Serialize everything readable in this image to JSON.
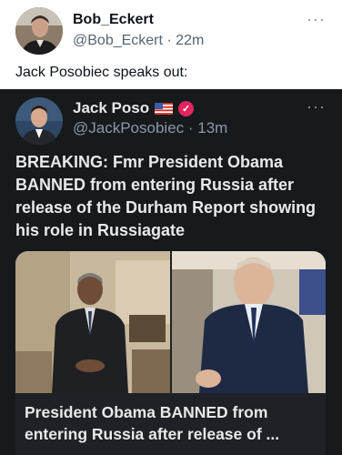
{
  "post": {
    "author_name": "Bob_Eckert",
    "author_handle": "@Bob_Eckert",
    "time": "22m",
    "meta_sep": " · ",
    "text": "Jack Posobiec speaks out:",
    "more_icon": "ellipsis-icon"
  },
  "quoted": {
    "author_name": "Jack Poso",
    "flag_icon": "us-flag-icon",
    "badge_icon": "verified-badge-icon",
    "badge_char": "✓",
    "author_handle": "@JackPosobiec",
    "time": "13m",
    "meta_sep": " · ",
    "text": "BREAKING: Fmr President Obama BANNED from entering Russia after release of the Durham Report showing his role in Russiagate",
    "more_icon": "ellipsis-icon"
  },
  "card": {
    "title": "President Obama BANNED from entering Russia after release of ..."
  },
  "colors": {
    "light_bg": "#ffffff",
    "dark_bg": "#161a1d",
    "verified": "#e0245e"
  }
}
